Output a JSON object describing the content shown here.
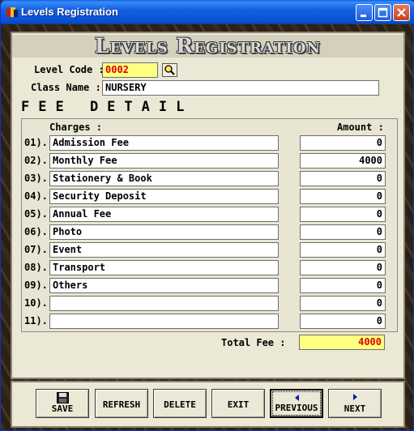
{
  "window": {
    "title": "Levels Registration"
  },
  "heading": "Levels Registration",
  "form": {
    "level_code_label": "Level Code :",
    "level_code_value": "0002",
    "class_name_label": "Class Name :",
    "class_name_value": "NURSERY"
  },
  "fee": {
    "title": "FEE DETAIL",
    "charges_header": "Charges :",
    "amount_header": "Amount :",
    "rows": [
      {
        "no": "01).",
        "charge": "Admission Fee",
        "amount": "0"
      },
      {
        "no": "02).",
        "charge": "Monthly Fee",
        "amount": "4000"
      },
      {
        "no": "03).",
        "charge": "Stationery & Book",
        "amount": "0"
      },
      {
        "no": "04).",
        "charge": "Security Deposit",
        "amount": "0"
      },
      {
        "no": "05).",
        "charge": "Annual Fee",
        "amount": "0"
      },
      {
        "no": "06).",
        "charge": "Photo",
        "amount": "0"
      },
      {
        "no": "07).",
        "charge": "Event",
        "amount": "0"
      },
      {
        "no": "08).",
        "charge": "Transport",
        "amount": "0"
      },
      {
        "no": "09).",
        "charge": "Others",
        "amount": "0"
      },
      {
        "no": "10).",
        "charge": "",
        "amount": "0"
      },
      {
        "no": "11).",
        "charge": "",
        "amount": "0"
      }
    ],
    "total_label": "Total Fee :",
    "total_value": "4000"
  },
  "buttons": {
    "save": "SAVE",
    "refresh": "REFRESH",
    "delete": "DELETE",
    "exit": "EXIT",
    "previous": "PREVIOUS",
    "next": "NEXT"
  },
  "colors": {
    "titlebar": "#0a4fd2",
    "highlight_field": "#ffff80",
    "code_text": "#e00000"
  },
  "icons": [
    "app-icon",
    "minimize-icon",
    "maximize-icon",
    "close-icon",
    "search-icon",
    "save-icon",
    "previous-arrow-icon",
    "next-arrow-icon"
  ]
}
